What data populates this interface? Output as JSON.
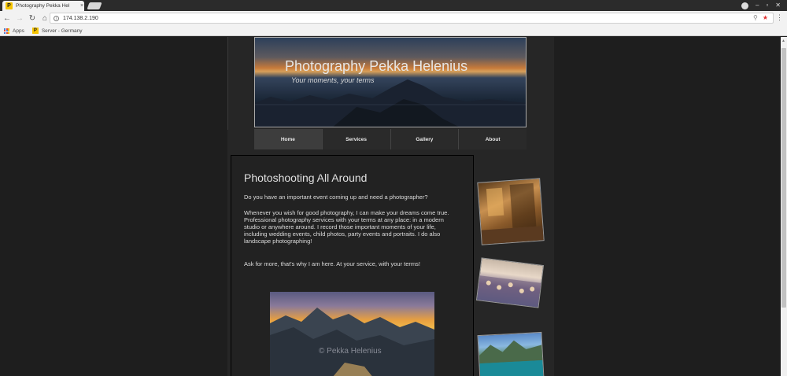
{
  "browser": {
    "tab_title": "Photography Pekka Hel",
    "tab_favicon": "P",
    "tab_close": "×",
    "url": "174.138.2.190",
    "bookmarks": [
      {
        "label": "Apps"
      },
      {
        "label": "Server - Germany",
        "favicon": "P"
      }
    ]
  },
  "site": {
    "title": "Photography Pekka Helenius",
    "tagline": "Your moments, your terms",
    "nav": [
      {
        "label": "Home",
        "active": true
      },
      {
        "label": "Services",
        "active": false
      },
      {
        "label": "Gallery",
        "active": false
      },
      {
        "label": "About",
        "active": false
      }
    ],
    "content": {
      "heading": "Photoshooting All Around",
      "paragraph1": "Do you have an important event coming up and need a photographer?",
      "paragraph2": "Whenever you wish for good photography, I can make your dreams come true. Professional photography services with your terms at any place: in a modern studio or anywhere around. I record those important moments of your life, including wedding events, child photos, party events and portraits. I do also landscape photographing!",
      "paragraph3": "Ask for more, that's why I am here. At your service, with your terms!",
      "image_watermark": "© Pekka Helenius"
    }
  }
}
